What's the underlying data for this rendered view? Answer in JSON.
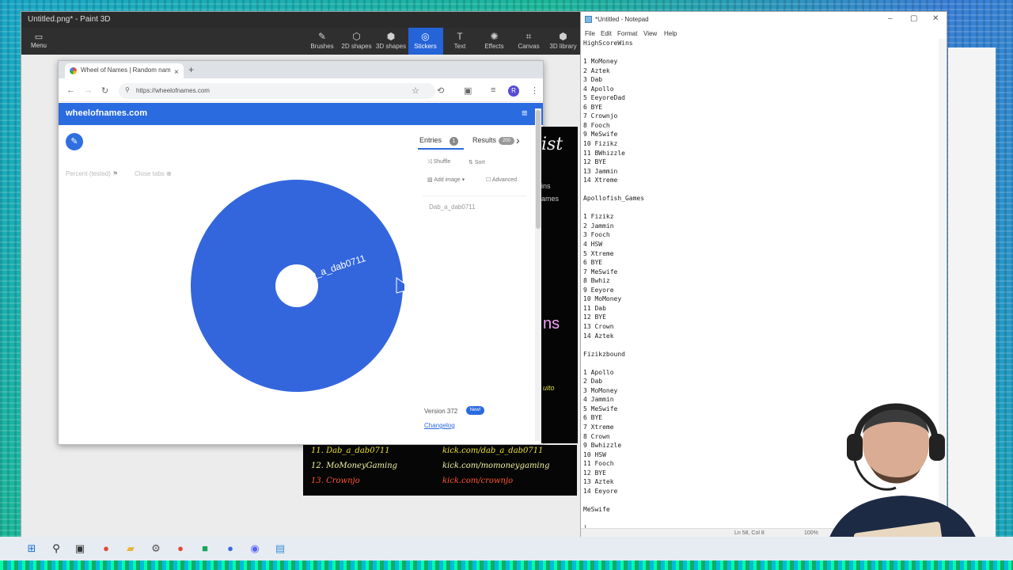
{
  "paint": {
    "title": "Untitled.png* - Paint 3D",
    "menu_label": "Menu",
    "tools": [
      {
        "icon": "brush-icon",
        "glyph": "✎",
        "label": "Brushes"
      },
      {
        "icon": "2d-shapes-icon",
        "glyph": "⬡",
        "label": "2D shapes"
      },
      {
        "icon": "3d-shapes-icon",
        "glyph": "⬢",
        "label": "3D shapes"
      },
      {
        "icon": "stickers-icon",
        "glyph": "◎",
        "label": "Stickers"
      },
      {
        "icon": "text-icon",
        "glyph": "T",
        "label": "Text"
      },
      {
        "icon": "effects-icon",
        "glyph": "✺",
        "label": "Effects"
      },
      {
        "icon": "canvas-icon",
        "glyph": "⌗",
        "label": "Canvas"
      },
      {
        "icon": "3d-library-icon",
        "glyph": "⬢",
        "label": "3D library"
      }
    ],
    "active_tool": "Stickers"
  },
  "browser": {
    "tab_title": "Wheel of Names | Random nam",
    "url": "https://wheelofnames.com",
    "avatar_letter": "R"
  },
  "site": {
    "title": "wheelofnames.com",
    "left_links": [
      "Percent (tested)",
      "Close tabs"
    ],
    "entries_label": "Entries",
    "entries_count": "1",
    "results_label": "Results",
    "results_count": "200",
    "shuffle_label": "Shuffle",
    "sort_label": "Sort",
    "add_image_label": "Add image",
    "advanced_label": "Advanced",
    "entries": [
      "Dab_a_dab0711"
    ],
    "wheel_label": "Dab_a_dab0711",
    "version_label": "Version 372",
    "new_badge": "New!",
    "changelog_label": "Changelog"
  },
  "colors": {
    "wheel": "#3366dd",
    "site_header": "#2a6be0",
    "paint_active": "#2563d8"
  },
  "overlay": {
    "side_words": [
      "ist",
      "ins",
      "ames",
      "ns",
      "uito"
    ],
    "lines": [
      {
        "name": "11. Dab_a_dab0711",
        "link": "kick.com/dab_a_dab0711",
        "color": "#e8e030"
      },
      {
        "name": "12. MoMoneyGaming",
        "link": "kick.com/momoneygaming",
        "color": "#f2f2a0"
      },
      {
        "name": "13. Crownjo",
        "link": "kick.com/crownjo",
        "color": "#ff5533"
      }
    ]
  },
  "notepad": {
    "title": "*Untitled - Notepad",
    "menus": [
      "File",
      "Edit",
      "Format",
      "View",
      "Help"
    ],
    "content": [
      "HighScoreWins",
      "",
      "1 MoMoney",
      "2 Aztek",
      "3 Dab",
      "4 Apollo",
      "5 EeyoreDad",
      "6 BYE",
      "7 Crownjo",
      "8 Fooch",
      "9 MeSwife",
      "10 Fizikz",
      "11 BWhizzle",
      "12 BYE",
      "13 Jammin",
      "14 Xtreme",
      "",
      "Apollofish_Games",
      "",
      "1 Fizikz",
      "2 Jammin",
      "3 Fooch",
      "4 HSW",
      "5 Xtreme",
      "6 BYE",
      "7 MeSwife",
      "8 Bwhiz",
      "9 Eeyore",
      "10 MoMoney",
      "11 Dab",
      "12 BYE",
      "13 Crown",
      "14 Aztek",
      "",
      "Fizikzbound",
      "",
      "1 Apollo",
      "2 Dab",
      "3 MoMoney",
      "4 Jammin",
      "5 MeSwife",
      "6 BYE",
      "7 Xtreme",
      "8 Crown",
      "9 Bwhizzle",
      "10 HSW",
      "11 Fooch",
      "12 BYE",
      "13 Aztek",
      "14 Eeyore",
      "",
      "MeSwife",
      "",
      "|"
    ],
    "status_position": "Ln 58, Col 8",
    "status_zoom": "100%"
  },
  "taskbar": {
    "icons": [
      {
        "name": "start-icon",
        "glyph": "⊞",
        "color": "#1b6fd1"
      },
      {
        "name": "search-icon",
        "glyph": "⚲",
        "color": "#222"
      },
      {
        "name": "task-view-icon",
        "glyph": "▣",
        "color": "#333"
      },
      {
        "name": "chrome-icon",
        "glyph": "●",
        "color": "#e04a3a"
      },
      {
        "name": "file-explorer-icon",
        "glyph": "▰",
        "color": "#e8b33a"
      },
      {
        "name": "settings-icon",
        "glyph": "⚙",
        "color": "#555"
      },
      {
        "name": "chrome-icon-2",
        "glyph": "●",
        "color": "#e04a3a"
      },
      {
        "name": "app-icon-green",
        "glyph": "■",
        "color": "#1aa55a"
      },
      {
        "name": "app-icon-blue",
        "glyph": "●",
        "color": "#3a6bd8"
      },
      {
        "name": "discord-icon",
        "glyph": "◉",
        "color": "#5865f2"
      },
      {
        "name": "notepad-icon",
        "glyph": "▤",
        "color": "#3a8fd6"
      }
    ]
  }
}
